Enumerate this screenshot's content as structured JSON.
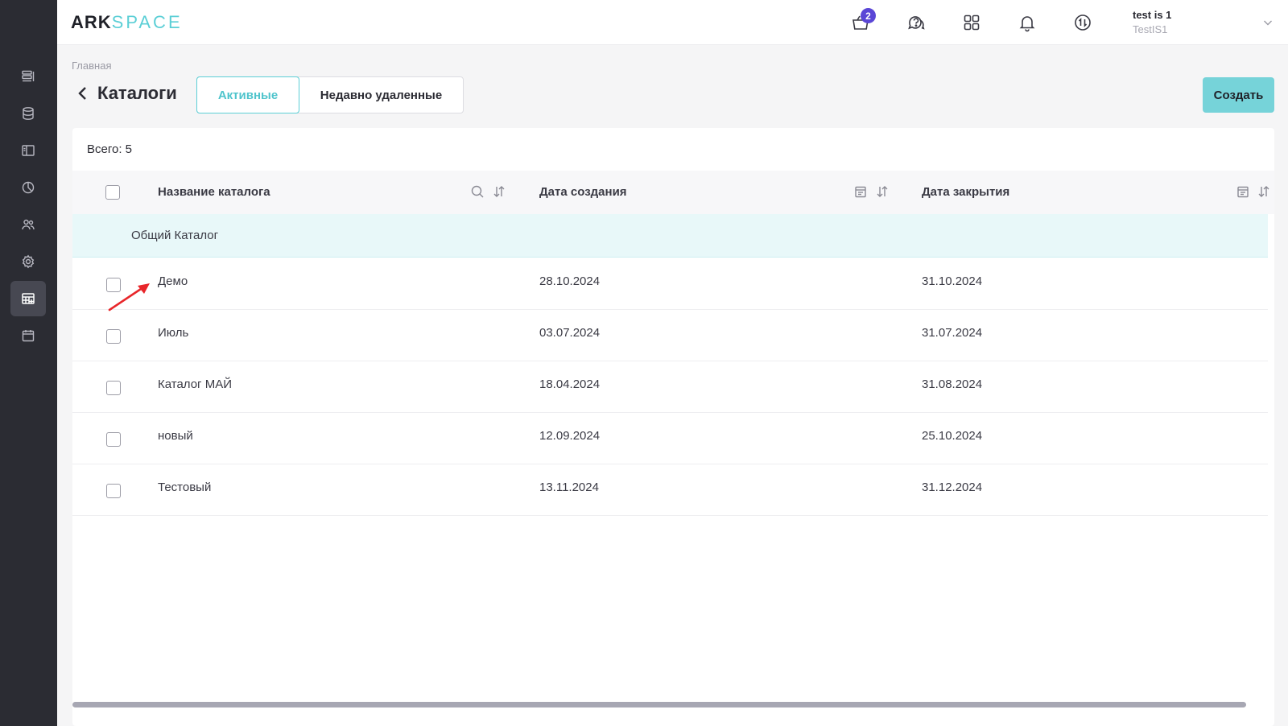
{
  "app": {
    "logo_part1": "ARK",
    "logo_part2": "SPACE"
  },
  "sidebar": {
    "items": [
      {
        "icon": "layers-icon",
        "active": false
      },
      {
        "icon": "database-icon",
        "active": false
      },
      {
        "icon": "panel-icon",
        "active": false
      },
      {
        "icon": "pie-chart-icon",
        "active": false
      },
      {
        "icon": "users-icon",
        "active": false
      },
      {
        "icon": "gear-icon",
        "active": false
      },
      {
        "icon": "catalog-icon",
        "active": true
      },
      {
        "icon": "calendar-icon",
        "active": false
      }
    ]
  },
  "header": {
    "cart_count": "2",
    "user_name": "test is 1",
    "user_org": "TestIS1"
  },
  "page": {
    "breadcrumb": "Главная",
    "title": "Каталоги",
    "tabs": [
      "Активные",
      "Недавно удаленные"
    ],
    "create_label": "Создать"
  },
  "table": {
    "total_label": "Всего: 5",
    "columns": [
      "Название каталога",
      "Дата создания",
      "Дата закрытия"
    ],
    "group_label": "Общий Каталог",
    "rows": [
      {
        "name": "Демо",
        "created": "28.10.2024",
        "closed": "31.10.2024"
      },
      {
        "name": "Июль",
        "created": "03.07.2024",
        "closed": "31.07.2024"
      },
      {
        "name": "Каталог МАЙ",
        "created": "18.04.2024",
        "closed": "31.08.2024"
      },
      {
        "name": "новый",
        "created": "12.09.2024",
        "closed": "25.10.2024"
      },
      {
        "name": "Тестовый",
        "created": "13.11.2024",
        "closed": "31.12.2024"
      }
    ]
  },
  "colors": {
    "accent": "#5ccfd6",
    "sidebar_bg": "#2b2c33",
    "badge": "#5a46d6",
    "annotation_arrow": "#e8262a"
  }
}
